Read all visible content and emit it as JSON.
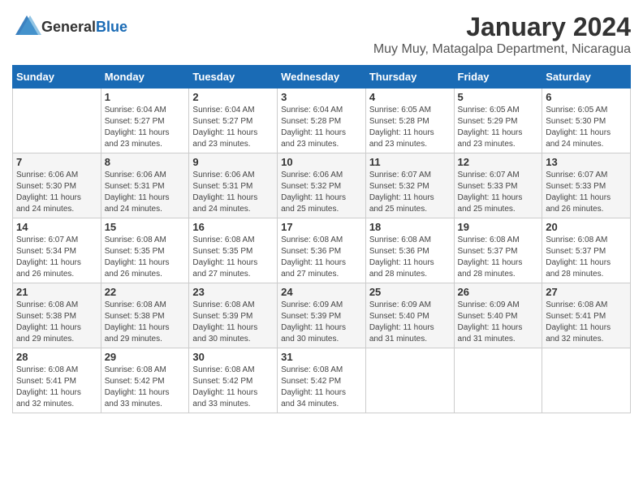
{
  "header": {
    "logo_general": "General",
    "logo_blue": "Blue",
    "month_title": "January 2024",
    "location": "Muy Muy, Matagalpa Department, Nicaragua"
  },
  "days_of_week": [
    "Sunday",
    "Monday",
    "Tuesday",
    "Wednesday",
    "Thursday",
    "Friday",
    "Saturday"
  ],
  "weeks": [
    [
      {
        "day": "",
        "info": ""
      },
      {
        "day": "1",
        "info": "Sunrise: 6:04 AM\nSunset: 5:27 PM\nDaylight: 11 hours\nand 23 minutes."
      },
      {
        "day": "2",
        "info": "Sunrise: 6:04 AM\nSunset: 5:27 PM\nDaylight: 11 hours\nand 23 minutes."
      },
      {
        "day": "3",
        "info": "Sunrise: 6:04 AM\nSunset: 5:28 PM\nDaylight: 11 hours\nand 23 minutes."
      },
      {
        "day": "4",
        "info": "Sunrise: 6:05 AM\nSunset: 5:28 PM\nDaylight: 11 hours\nand 23 minutes."
      },
      {
        "day": "5",
        "info": "Sunrise: 6:05 AM\nSunset: 5:29 PM\nDaylight: 11 hours\nand 23 minutes."
      },
      {
        "day": "6",
        "info": "Sunrise: 6:05 AM\nSunset: 5:30 PM\nDaylight: 11 hours\nand 24 minutes."
      }
    ],
    [
      {
        "day": "7",
        "info": "Sunrise: 6:06 AM\nSunset: 5:30 PM\nDaylight: 11 hours\nand 24 minutes."
      },
      {
        "day": "8",
        "info": "Sunrise: 6:06 AM\nSunset: 5:31 PM\nDaylight: 11 hours\nand 24 minutes."
      },
      {
        "day": "9",
        "info": "Sunrise: 6:06 AM\nSunset: 5:31 PM\nDaylight: 11 hours\nand 24 minutes."
      },
      {
        "day": "10",
        "info": "Sunrise: 6:06 AM\nSunset: 5:32 PM\nDaylight: 11 hours\nand 25 minutes."
      },
      {
        "day": "11",
        "info": "Sunrise: 6:07 AM\nSunset: 5:32 PM\nDaylight: 11 hours\nand 25 minutes."
      },
      {
        "day": "12",
        "info": "Sunrise: 6:07 AM\nSunset: 5:33 PM\nDaylight: 11 hours\nand 25 minutes."
      },
      {
        "day": "13",
        "info": "Sunrise: 6:07 AM\nSunset: 5:33 PM\nDaylight: 11 hours\nand 26 minutes."
      }
    ],
    [
      {
        "day": "14",
        "info": "Sunrise: 6:07 AM\nSunset: 5:34 PM\nDaylight: 11 hours\nand 26 minutes."
      },
      {
        "day": "15",
        "info": "Sunrise: 6:08 AM\nSunset: 5:35 PM\nDaylight: 11 hours\nand 26 minutes."
      },
      {
        "day": "16",
        "info": "Sunrise: 6:08 AM\nSunset: 5:35 PM\nDaylight: 11 hours\nand 27 minutes."
      },
      {
        "day": "17",
        "info": "Sunrise: 6:08 AM\nSunset: 5:36 PM\nDaylight: 11 hours\nand 27 minutes."
      },
      {
        "day": "18",
        "info": "Sunrise: 6:08 AM\nSunset: 5:36 PM\nDaylight: 11 hours\nand 28 minutes."
      },
      {
        "day": "19",
        "info": "Sunrise: 6:08 AM\nSunset: 5:37 PM\nDaylight: 11 hours\nand 28 minutes."
      },
      {
        "day": "20",
        "info": "Sunrise: 6:08 AM\nSunset: 5:37 PM\nDaylight: 11 hours\nand 28 minutes."
      }
    ],
    [
      {
        "day": "21",
        "info": "Sunrise: 6:08 AM\nSunset: 5:38 PM\nDaylight: 11 hours\nand 29 minutes."
      },
      {
        "day": "22",
        "info": "Sunrise: 6:08 AM\nSunset: 5:38 PM\nDaylight: 11 hours\nand 29 minutes."
      },
      {
        "day": "23",
        "info": "Sunrise: 6:08 AM\nSunset: 5:39 PM\nDaylight: 11 hours\nand 30 minutes."
      },
      {
        "day": "24",
        "info": "Sunrise: 6:09 AM\nSunset: 5:39 PM\nDaylight: 11 hours\nand 30 minutes."
      },
      {
        "day": "25",
        "info": "Sunrise: 6:09 AM\nSunset: 5:40 PM\nDaylight: 11 hours\nand 31 minutes."
      },
      {
        "day": "26",
        "info": "Sunrise: 6:09 AM\nSunset: 5:40 PM\nDaylight: 11 hours\nand 31 minutes."
      },
      {
        "day": "27",
        "info": "Sunrise: 6:08 AM\nSunset: 5:41 PM\nDaylight: 11 hours\nand 32 minutes."
      }
    ],
    [
      {
        "day": "28",
        "info": "Sunrise: 6:08 AM\nSunset: 5:41 PM\nDaylight: 11 hours\nand 32 minutes."
      },
      {
        "day": "29",
        "info": "Sunrise: 6:08 AM\nSunset: 5:42 PM\nDaylight: 11 hours\nand 33 minutes."
      },
      {
        "day": "30",
        "info": "Sunrise: 6:08 AM\nSunset: 5:42 PM\nDaylight: 11 hours\nand 33 minutes."
      },
      {
        "day": "31",
        "info": "Sunrise: 6:08 AM\nSunset: 5:42 PM\nDaylight: 11 hours\nand 34 minutes."
      },
      {
        "day": "",
        "info": ""
      },
      {
        "day": "",
        "info": ""
      },
      {
        "day": "",
        "info": ""
      }
    ]
  ]
}
